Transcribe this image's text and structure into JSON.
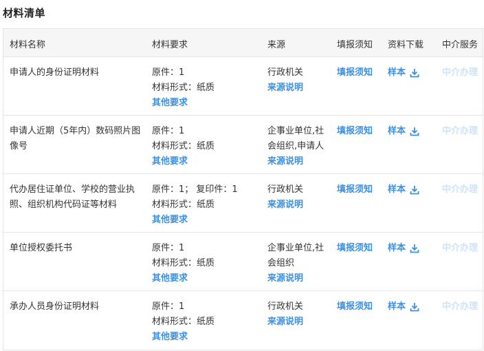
{
  "page": {
    "title": "材料清单"
  },
  "columns": {
    "name": "材料名称",
    "requirement": "材料要求",
    "source": "来源",
    "notice": "填报须知",
    "download": "资料下载",
    "agency": "中介服务"
  },
  "rows": [
    {
      "name": "申请人的身份证明材料",
      "original": "原件：1",
      "form": "材料形式：纸质",
      "other_req": "其他要求",
      "source": "行政机关",
      "source_note": "来源说明",
      "notice": "填报须知",
      "sample": "样本",
      "agency": "中介办理"
    },
    {
      "name": "申请人近期（5年内）数码照片图像号",
      "original": "原件：1",
      "form": "材料形式：纸质",
      "other_req": "其他要求",
      "source": "企事业单位,社会组织,申请人",
      "source_note": "来源说明",
      "notice": "填报须知",
      "sample": "样本",
      "agency": "中介办理"
    },
    {
      "name": "代办居住证单位、学校的营业执照、组织机构代码证等材料",
      "original": "原件：1； 复印件：1",
      "form": "材料形式：纸质",
      "other_req": "其他要求",
      "source": "行政机关",
      "source_note": "来源说明",
      "notice": "填报须知",
      "sample": "样本",
      "agency": "中介办理"
    },
    {
      "name": "单位授权委托书",
      "original": "原件：1",
      "form": "材料形式：纸质",
      "other_req": "其他要求",
      "source": "企事业单位,社会组织",
      "source_note": "来源说明",
      "notice": "填报须知",
      "sample": "样本",
      "agency": "中介办理"
    },
    {
      "name": "承办人员身份证明材料",
      "original": "原件：1",
      "form": "材料形式：纸质",
      "other_req": "其他要求",
      "source": "行政机关",
      "source_note": "来源说明",
      "notice": "填报须知",
      "sample": "样本",
      "agency": "中介办理"
    }
  ],
  "icons": {
    "download": "download-icon"
  },
  "colors": {
    "link": "#3d8fe0",
    "disabled_link": "#cfe3f8",
    "header_bg": "#f6f6f6",
    "border": "#e4e4e4"
  }
}
